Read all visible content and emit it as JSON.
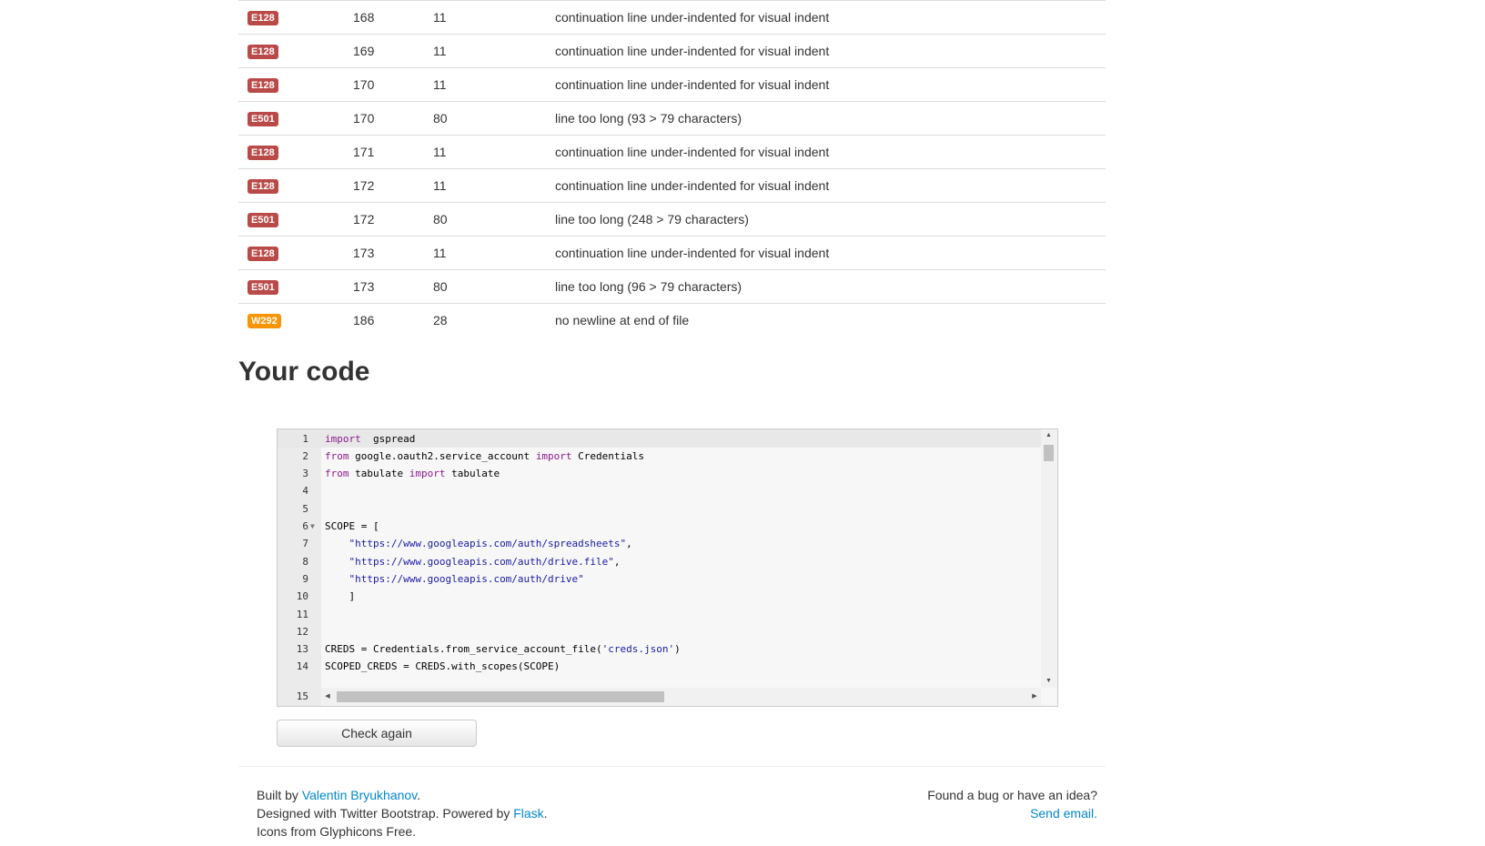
{
  "results": {
    "rows": [
      {
        "code": "E128",
        "level": "error",
        "line": "168",
        "column": "11",
        "message": "continuation line under-indented for visual indent"
      },
      {
        "code": "E128",
        "level": "error",
        "line": "169",
        "column": "11",
        "message": "continuation line under-indented for visual indent"
      },
      {
        "code": "E128",
        "level": "error",
        "line": "170",
        "column": "11",
        "message": "continuation line under-indented for visual indent"
      },
      {
        "code": "E501",
        "level": "error",
        "line": "170",
        "column": "80",
        "message": "line too long (93 > 79 characters)"
      },
      {
        "code": "E128",
        "level": "error",
        "line": "171",
        "column": "11",
        "message": "continuation line under-indented for visual indent"
      },
      {
        "code": "E128",
        "level": "error",
        "line": "172",
        "column": "11",
        "message": "continuation line under-indented for visual indent"
      },
      {
        "code": "E501",
        "level": "error",
        "line": "172",
        "column": "80",
        "message": "line too long (248 > 79 characters)"
      },
      {
        "code": "E128",
        "level": "error",
        "line": "173",
        "column": "11",
        "message": "continuation line under-indented for visual indent"
      },
      {
        "code": "E501",
        "level": "error",
        "line": "173",
        "column": "80",
        "message": "line too long (96 > 79 characters)"
      },
      {
        "code": "W292",
        "level": "warning",
        "line": "186",
        "column": "28",
        "message": "no newline at end of file"
      }
    ]
  },
  "section_title": "Your code",
  "editor": {
    "lines": [
      {
        "n": "1",
        "tokens": [
          [
            "kw",
            "import"
          ],
          [
            "",
            "  gspread"
          ]
        ]
      },
      {
        "n": "2",
        "tokens": [
          [
            "kw",
            "from"
          ],
          [
            "",
            " google.oauth2.service_account "
          ],
          [
            "kw",
            "import"
          ],
          [
            "",
            " Credentials"
          ]
        ]
      },
      {
        "n": "3",
        "tokens": [
          [
            "kw",
            "from"
          ],
          [
            "",
            " tabulate "
          ],
          [
            "kw",
            "import"
          ],
          [
            "",
            " tabulate"
          ]
        ]
      },
      {
        "n": "4",
        "tokens": []
      },
      {
        "n": "5",
        "tokens": []
      },
      {
        "n": "6",
        "fold": true,
        "tokens": [
          [
            "",
            "SCOPE = ["
          ]
        ]
      },
      {
        "n": "7",
        "tokens": [
          [
            "",
            "    "
          ],
          [
            "str",
            "\"https://www.googleapis.com/auth/spreadsheets\""
          ],
          [
            "",
            ","
          ]
        ]
      },
      {
        "n": "8",
        "tokens": [
          [
            "",
            "    "
          ],
          [
            "str",
            "\"https://www.googleapis.com/auth/drive.file\""
          ],
          [
            "",
            ","
          ]
        ]
      },
      {
        "n": "9",
        "tokens": [
          [
            "",
            "    "
          ],
          [
            "str",
            "\"https://www.googleapis.com/auth/drive\""
          ]
        ]
      },
      {
        "n": "10",
        "tokens": [
          [
            "",
            "    ]"
          ]
        ]
      },
      {
        "n": "11",
        "tokens": []
      },
      {
        "n": "12",
        "tokens": []
      },
      {
        "n": "13",
        "tokens": [
          [
            "",
            "CREDS = Credentials.from_service_account_file("
          ],
          [
            "str",
            "'creds.json'"
          ],
          [
            "",
            ")"
          ]
        ]
      },
      {
        "n": "14",
        "tokens": [
          [
            "",
            "SCOPED_CREDS = CREDS.with_scopes(SCOPE)"
          ]
        ]
      }
    ],
    "partial_line_number": "15",
    "fold_icon": "fold-arrow-icon",
    "scroll_up_icon": "triangle-up-icon",
    "scroll_down_icon": "triangle-down-icon",
    "scroll_left_icon": "triangle-left-icon",
    "scroll_right_icon": "triangle-right-icon"
  },
  "check_button_label": "Check again",
  "footer": {
    "built_by_prefix": "Built by ",
    "author_link": "Valentin Bryukhanov",
    "built_by_suffix": ".",
    "designed_prefix": "Designed with Twitter Bootstrap. Powered by ",
    "flask_link": "Flask",
    "designed_suffix": ".",
    "icons_text": "Icons from Glyphicons Free.",
    "bug_text": "Found a bug or have an idea?",
    "email_link": "Send email."
  },
  "colors": {
    "error_badge": "#b94a48",
    "warning_badge": "#f89406",
    "link": "#0088cc",
    "keyword": "#8b1a8b",
    "string": "#1a1aa6"
  }
}
